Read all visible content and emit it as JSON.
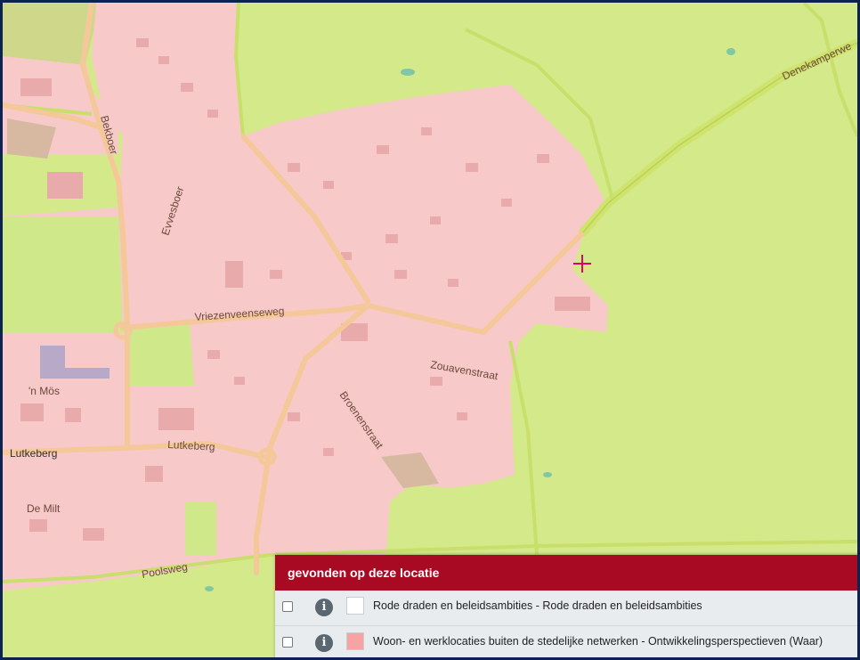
{
  "map": {
    "colors": {
      "background": "#d3e98a",
      "built_area": "#f7c9c9",
      "road": "#f5c899",
      "highway": "#cfe36d",
      "water": "#7fc7a5",
      "industrial": "#b9a9c9",
      "bare": "#d6b9a0",
      "marker": "#e0006c"
    },
    "street_labels": {
      "bekboer": "Bekboer",
      "evvesboer": "Evvesboer",
      "vriezenveenseweg": "Vriezenveenseweg",
      "denekamperweg": "Denekamperwe",
      "zouavenstraat": "Zouavenstraat",
      "broenenstraat": "Broenenstraat",
      "lutkeberg_center": "Lutkeberg",
      "lutkeberg_west": "Lutkeberg",
      "n_mos": "'n Mös",
      "de_milt": "De Milt",
      "poolsweg": "Poolsweg"
    },
    "marker_icon": "crosshair-icon"
  },
  "panel": {
    "title": "gevonden op deze locatie",
    "rows": [
      {
        "checked": false,
        "info_icon": "info-icon",
        "swatch_color": "#ffffff",
        "label": "Rode draden en beleidsambities - Rode draden en beleidsambities"
      },
      {
        "checked": false,
        "info_icon": "info-icon",
        "swatch_color": "#f7a3a3",
        "label": "Woon- en werklocaties buiten de stedelijke netwerken - Ontwikkelingsperspectieven (Waar)"
      }
    ]
  }
}
